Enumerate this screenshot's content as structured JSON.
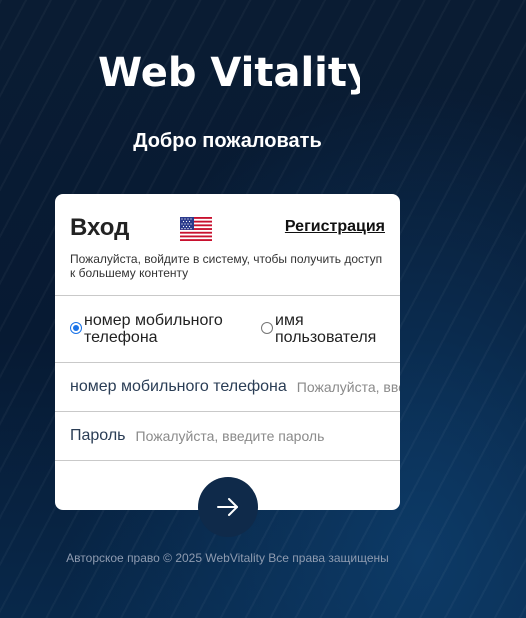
{
  "brand": {
    "logo_text": "Web Vitality"
  },
  "header": {
    "welcome": "Добро пожаловать"
  },
  "login": {
    "title": "Вход",
    "flag_icon": "us-flag-icon",
    "register_link": "Регистрация",
    "subtitle": "Пожалуйста, войдите в систему, чтобы получить доступ к большему контенту",
    "login_modes": [
      {
        "label": "номер мобильного телефона",
        "selected": true
      },
      {
        "label": "имя пользователя",
        "selected": false
      }
    ],
    "phone_field": {
      "label": "номер мобильного телефона",
      "placeholder": "Пожалуйста, введите номер телефона"
    },
    "password_field": {
      "label": "Пароль",
      "placeholder": "Пожалуйста, введите пароль"
    },
    "submit_icon": "arrow-right-icon"
  },
  "footer": {
    "copyright": "Авторское право © 2025 WebVitality Все права защищены"
  },
  "colors": {
    "background": "#071a33",
    "button": "#0f2a4a",
    "radio_accent": "#1a73e8"
  }
}
